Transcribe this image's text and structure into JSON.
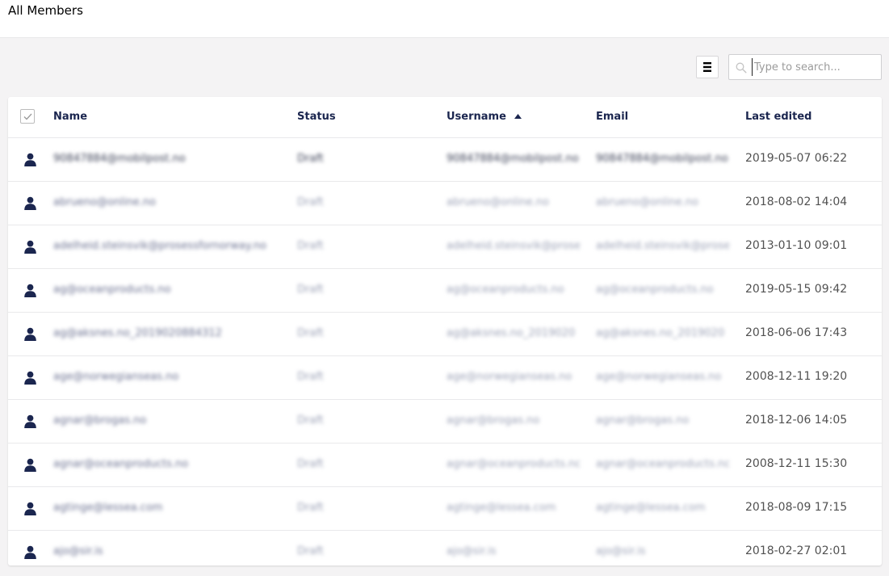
{
  "header": {
    "title": "All Members"
  },
  "toolbar": {
    "layout_icon": "list-layout-icon",
    "search": {
      "placeholder": "Type to search...",
      "value": "",
      "icon": "search-icon"
    }
  },
  "table": {
    "columns": {
      "name": "Name",
      "status": "Status",
      "username": "Username",
      "email": "Email",
      "last_edited": "Last edited"
    },
    "sort": {
      "column": "Username",
      "direction": "ascending",
      "icon": "sort-ascending-icon"
    },
    "rows": [
      {
        "name": "90847884@mobilpost.no",
        "status": "Draft",
        "username": "90847884@mobilpost.no",
        "email": "90847884@mobilpost.no",
        "last_edited": "2019-05-07 06:22"
      },
      {
        "name": "abrueno@online.no",
        "status": "Draft",
        "username": "abrueno@online.no",
        "email": "abrueno@online.no",
        "last_edited": "2018-08-02 14:04"
      },
      {
        "name": "adelheid.steinsvik@prosessfornorway.no",
        "status": "Draft",
        "username": "adelheid.steinsvik@prose",
        "email": "adelheid.steinsvik@prose",
        "last_edited": "2013-01-10 09:01"
      },
      {
        "name": "ag@oceanproducts.no",
        "status": "Draft",
        "username": "ag@oceanproducts.no",
        "email": "ag@oceanproducts.no",
        "last_edited": "2019-05-15 09:42"
      },
      {
        "name": "ag@aksnes.no_2019020884312",
        "status": "Draft",
        "username": "ag@aksnes.no_2019020",
        "email": "ag@aksnes.no_2019020",
        "last_edited": "2018-06-06 17:43"
      },
      {
        "name": "age@norwegianseas.no",
        "status": "Draft",
        "username": "age@norwegianseas.no",
        "email": "age@norwegianseas.no",
        "last_edited": "2008-12-11 19:20"
      },
      {
        "name": "agnar@brogas.no",
        "status": "Draft",
        "username": "agnar@brogas.no",
        "email": "agnar@brogas.no",
        "last_edited": "2018-12-06 14:05"
      },
      {
        "name": "agnar@oceanproducts.no",
        "status": "Draft",
        "username": "agnar@oceanproducts.no",
        "email": "agnar@oceanproducts.no",
        "last_edited": "2008-12-11 15:30"
      },
      {
        "name": "agtinge@lessea.com",
        "status": "Draft",
        "username": "agtinge@lessea.com",
        "email": "agtinge@lessea.com",
        "last_edited": "2018-08-09 17:15"
      },
      {
        "name": "ajo@sir.is",
        "status": "Draft",
        "username": "ajo@sir.is",
        "email": "ajo@sir.is",
        "last_edited": "2018-02-27 02:01"
      }
    ]
  },
  "colors": {
    "background": "#f4f3f4",
    "header_bg": "#ffffff",
    "text_primary": "#1b264f",
    "text_secondary": "#515151",
    "border": "#e9e9eb",
    "icon": "#1b264f"
  }
}
